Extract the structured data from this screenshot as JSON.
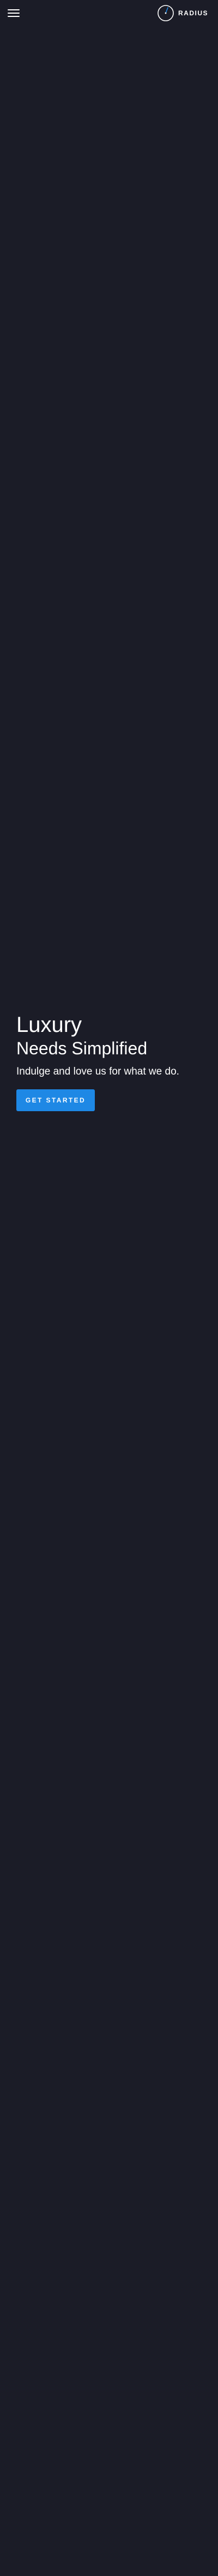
{
  "header": {
    "menu_icon": "hamburger-menu-icon",
    "logo_icon": "radius-logo-icon",
    "logo_text": "RADIUS"
  },
  "hero": {
    "title": "Luxury",
    "subtitle": "Needs Simplified",
    "tagline": "Indulge and love us for what we do.",
    "cta_label": "GET STARTED"
  },
  "colors": {
    "background": "#1b1c27",
    "accent": "#1e88e5",
    "text": "#ffffff",
    "logo_ring": "#ffffff"
  }
}
